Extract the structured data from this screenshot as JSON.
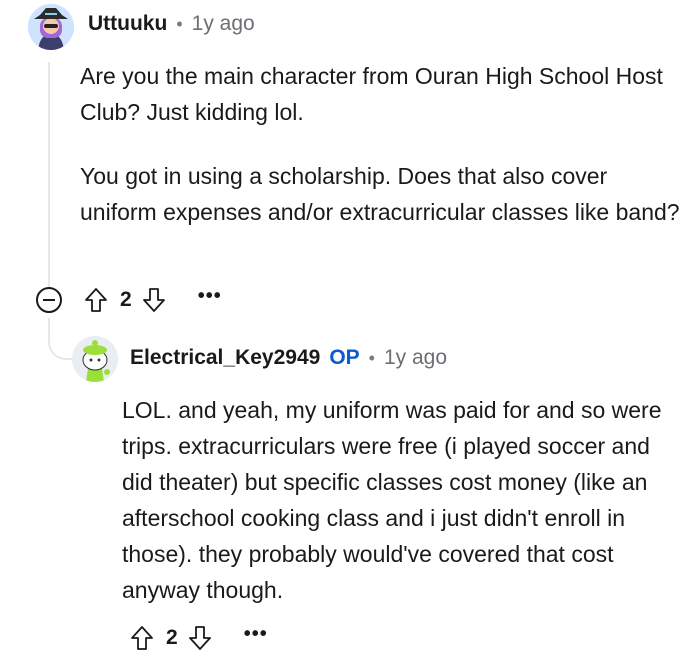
{
  "comment": {
    "author": "Uttuuku",
    "separator": "•",
    "time": "1y ago",
    "paragraphs": [
      "Are you the main character from Ouran High School Host Club? Just kidding lol.",
      "You got in using a scholarship. Does that also cover uniform expenses and/or extracurricular classes like band?"
    ],
    "score": "2",
    "more": "•••",
    "icons": {
      "collapse": "collapse-minus-icon",
      "upvote": "upvote-arrow-icon",
      "downvote": "downvote-arrow-icon",
      "more": "more-options-icon"
    }
  },
  "reply": {
    "author": "Electrical_Key2949",
    "op_badge": "OP",
    "separator": "•",
    "time": "1y ago",
    "text": "LOL. and yeah, my uniform was paid for and so were trips. extracurriculars were free (i played soccer and did theater) but specific classes cost money (like an afterschool cooking class and i just didn't enroll in those). they probably would've covered that cost anyway though.",
    "score": "2",
    "more": "•••"
  },
  "colors": {
    "text": "#1a1a1b",
    "meta": "#6b6f73",
    "op_badge": "#0a5ad4",
    "thread_line": "#e5e7ea"
  }
}
